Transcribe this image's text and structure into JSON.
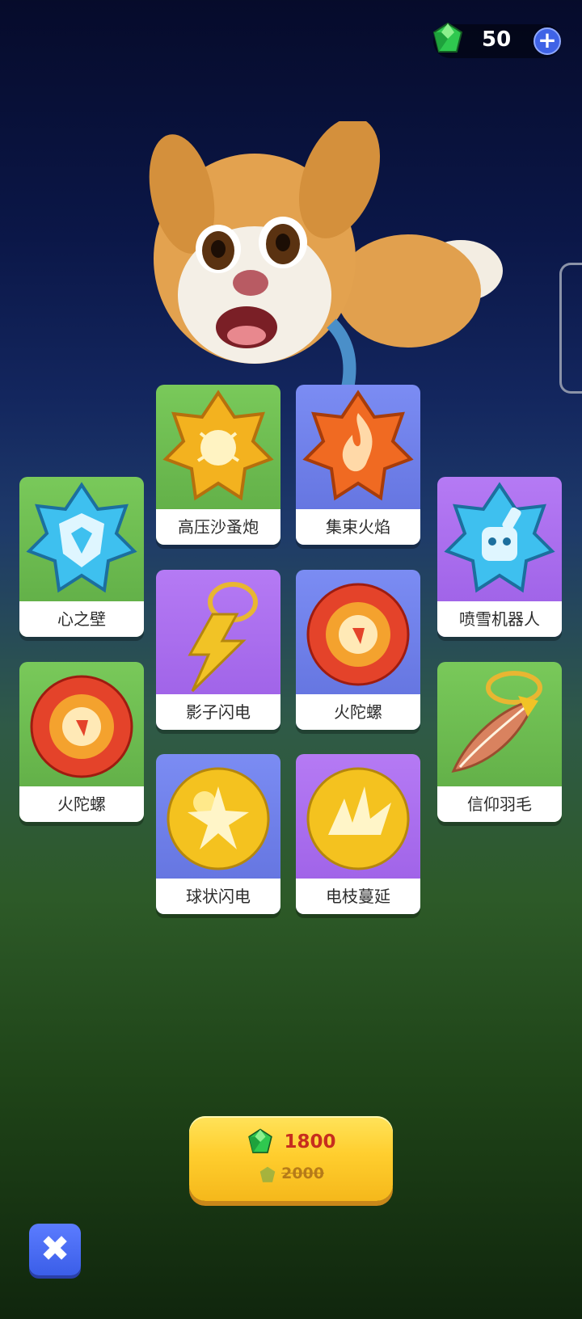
{
  "hud": {
    "gems": "50",
    "plus_icon": "plus-icon",
    "gem_icon": "green-gem-icon"
  },
  "cards": [
    {
      "label": "高压沙蚤炮",
      "bg": "green",
      "icon": "gold-star-spider-icon",
      "color": "#f3b21f"
    },
    {
      "label": "集束火焰",
      "bg": "blue",
      "icon": "orange-star-flame-icon",
      "color": "#f06a22"
    },
    {
      "label": "心之壁",
      "bg": "green",
      "icon": "blue-star-shield-icon",
      "color": "#3ec0ef"
    },
    {
      "label": "喷雪机器人",
      "bg": "purple",
      "icon": "blue-star-robot-icon",
      "color": "#3ec0ef"
    },
    {
      "label": "影子闪电",
      "bg": "purple",
      "icon": "lightning-charm-icon",
      "color": "#f1c326"
    },
    {
      "label": "火陀螺",
      "bg": "blue",
      "icon": "fire-orb-icon",
      "color": "#e4432a"
    },
    {
      "label": "火陀螺",
      "bg": "green",
      "icon": "fire-orb-icon",
      "color": "#e4432a"
    },
    {
      "label": "信仰羽毛",
      "bg": "green",
      "icon": "feather-charm-icon",
      "color": "#d9825f"
    },
    {
      "label": "球状闪电",
      "bg": "blue",
      "icon": "gold-lightning-orb-icon",
      "color": "#f4c21f"
    },
    {
      "label": "电枝蔓延",
      "bg": "purple",
      "icon": "gold-spark-orb-icon",
      "color": "#f4c21f"
    }
  ],
  "purchase": {
    "price": "1800",
    "original_price": "2000"
  },
  "close": {
    "label": "✖"
  }
}
